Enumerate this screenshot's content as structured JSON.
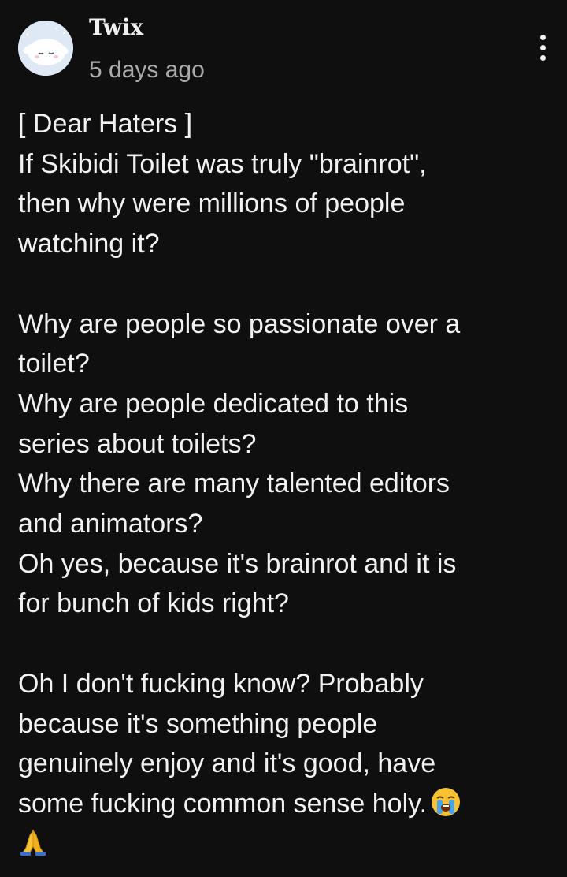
{
  "comment": {
    "author": "Twix",
    "timestamp": "5 days ago",
    "avatar_icon": "cinnamoroll-avatar",
    "menu_icon": "more-vertical-icon",
    "paragraphs": [
      "[ Dear Haters ]\nIf Skibidi Toilet was truly \"brainrot\",\nthen why were millions of people\nwatching it?",
      "Why are people so passionate over a\ntoilet?\nWhy are people dedicated to this\nseries about toilets?\nWhy there are many talented editors\nand animators?\nOh yes, because it's brainrot and it is\nfor bunch of kids right?",
      "Oh I don't fucking know? Probably\nbecause it's something people\ngenuinely enjoy and it's good, have\nsome fucking common sense holy."
    ],
    "trailing_emojis": [
      "loudly-crying-face",
      "folded-hands"
    ]
  },
  "colors": {
    "background": "#0f0f0f",
    "text": "#f1f1f1",
    "secondary_text": "#aaaaaa"
  }
}
